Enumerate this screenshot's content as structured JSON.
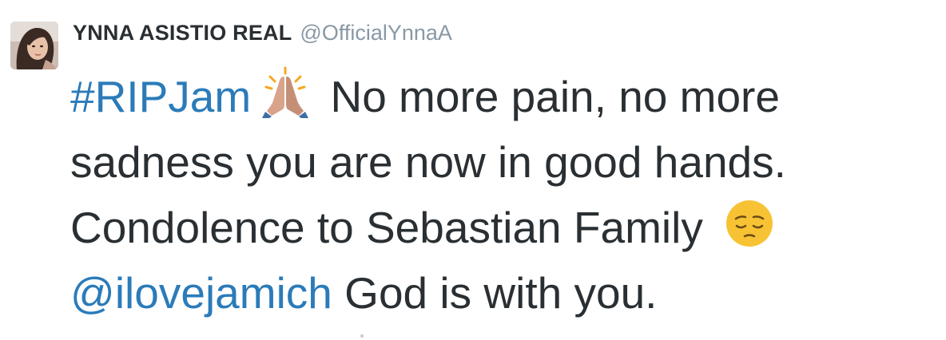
{
  "tweet": {
    "author": {
      "display_name": "YNNA ASISTIO REAL",
      "handle": "@OfficialYnnaA"
    },
    "text": {
      "hashtag": "#RIPJam",
      "line1_rest": " No more pain, no more",
      "line2": "sadness you are now in good hands.",
      "line3": "Condolence to Sebastian Family ",
      "mention": "@ilovejamich",
      "line4_rest": " God is with you."
    },
    "emojis": [
      "folded-hands-icon",
      "pensive-face-icon"
    ],
    "colors": {
      "text": "#292f33",
      "link": "#2b7bb9",
      "handle": "#8899a6"
    }
  }
}
